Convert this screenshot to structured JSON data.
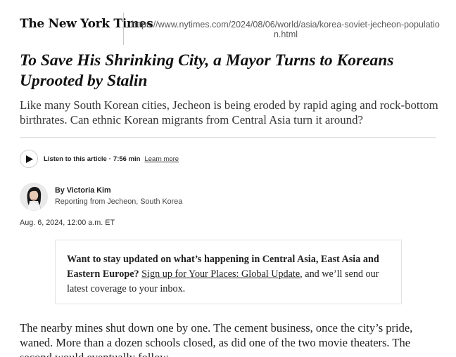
{
  "masthead": {
    "logo_text": "The New York Times",
    "url": "https://www.nytimes.com/2024/08/06/world/asia/korea-soviet-jecheon-population.html"
  },
  "article": {
    "headline": "To Save His Shrinking City, a Mayor Turns to Koreans Uprooted by Stalin",
    "summary": "Like many South Korean cities, Jecheon is being eroded by rapid aging and rock-bottom birthrates. Can ethnic Korean migrants from Central Asia turn it around?",
    "audio": {
      "label": "Listen to this article",
      "separator": "·",
      "duration": "7:56 min",
      "learn_more": "Learn more"
    },
    "byline": {
      "author": "By Victoria Kim",
      "location": "Reporting from Jecheon, South Korea"
    },
    "date": "Aug. 6, 2024, 12:00 a.m. ET",
    "promo": {
      "bold_text": "Want to stay updated on what’s happening in Central Asia, East Asia and Eastern Europe?",
      "link_text": "Sign up for Your Places: Global Update",
      "rest_text": ", and we’ll send our latest coverage to your inbox."
    },
    "body_paragraph": "The nearby mines shut down one by one. The cement business, once the city’s pride, waned. More than a dozen schools closed, as did one of the two movie theaters. The second would eventually follow."
  }
}
